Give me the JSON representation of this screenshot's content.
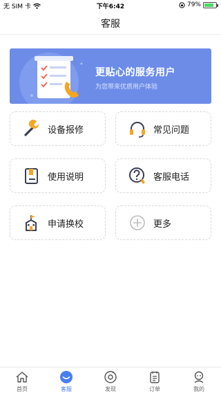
{
  "status_bar": {
    "carrier": "无 SIM 卡",
    "time": "下午6:42",
    "battery_percent": "79%",
    "battery_level": 0.79
  },
  "nav": {
    "title": "客服"
  },
  "banner": {
    "title": "更贴心的服务用户",
    "subtitle": "为您带来优质用户体验"
  },
  "services": [
    {
      "label": "设备报修",
      "icon": "wrench-icon"
    },
    {
      "label": "常见问题",
      "icon": "headset-icon"
    },
    {
      "label": "使用说明",
      "icon": "manual-icon"
    },
    {
      "label": "客服电话",
      "icon": "question-phone-icon"
    },
    {
      "label": "申请换校",
      "icon": "school-icon"
    },
    {
      "label": "更多",
      "icon": "plus-circle-icon"
    }
  ],
  "tabs": [
    {
      "label": "首页",
      "icon": "home-icon",
      "active": false
    },
    {
      "label": "客服",
      "icon": "service-icon",
      "active": true
    },
    {
      "label": "发现",
      "icon": "discover-icon",
      "active": false
    },
    {
      "label": "订单",
      "icon": "order-icon",
      "active": false
    },
    {
      "label": "我的",
      "icon": "profile-icon",
      "active": false
    }
  ],
  "colors": {
    "accent": "#4a7ef0",
    "banner_bg": "#6c8ce8",
    "icon_orange": "#f5a623",
    "icon_dark": "#3a3f55",
    "battery_green": "#4cd964"
  }
}
